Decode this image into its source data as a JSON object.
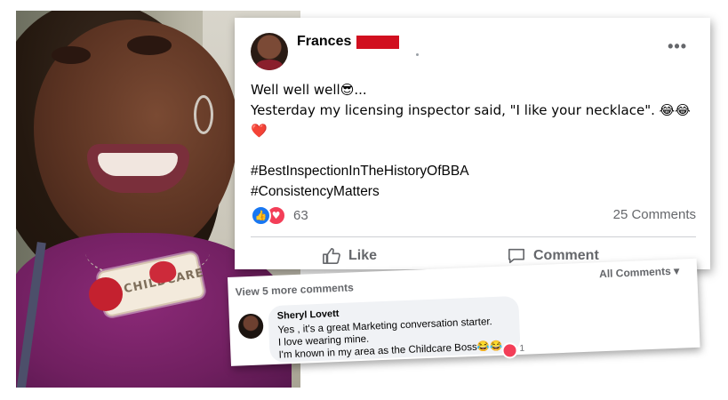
{
  "post": {
    "author_name": "Frances",
    "more_icon": "more-horizontal-icon",
    "lines": [
      "Well well well😎...",
      "Yesterday my licensing inspector said, \"I like your necklace\". 😂😂❤️",
      "#BestInspectionInTheHistoryOfBBA",
      "#ConsistencyMatters"
    ],
    "reactions_count": "63",
    "comments_count": "25 Comments",
    "actions": {
      "like": "Like",
      "comment": "Comment"
    },
    "colors": {
      "accent": "#1877f2",
      "love": "#f33e58",
      "redaction": "#d10f1f"
    }
  },
  "comments": {
    "view_more": "View 5 more comments",
    "filter": "All Comments",
    "items": [
      {
        "author": "Sheryl Lovett",
        "lines": [
          "Yes , it's a great Marketing conversation starter.",
          "I love wearing mine.",
          "I'm known in my area as the Childcare Boss😂😂"
        ],
        "reaction_count": "1"
      }
    ]
  },
  "photo": {
    "necklace_text": "CHILDCARE"
  }
}
